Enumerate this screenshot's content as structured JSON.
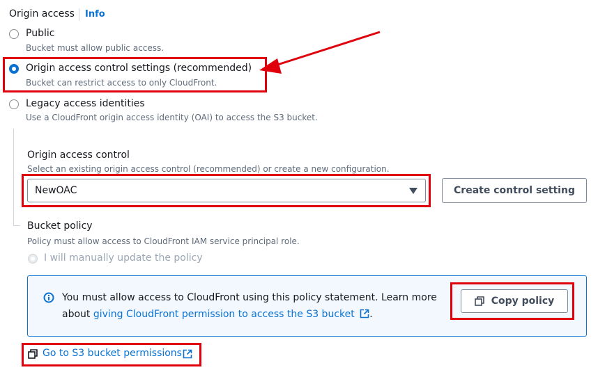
{
  "origin_access": {
    "title": "Origin access",
    "info": "Info",
    "options": [
      {
        "label": "Public",
        "desc": "Bucket must allow public access."
      },
      {
        "label": "Origin access control settings (recommended)",
        "desc": "Bucket can restrict access to only CloudFront."
      },
      {
        "label": "Legacy access identities",
        "desc": "Use a CloudFront origin access identity (OAI) to access the S3 bucket."
      }
    ],
    "selected_index": 1
  },
  "oac": {
    "label": "Origin access control",
    "desc": "Select an existing origin access control (recommended) or create a new configuration.",
    "value": "NewOAC",
    "create_button": "Create control setting"
  },
  "bucket_policy": {
    "label": "Bucket policy",
    "desc": "Policy must allow access to CloudFront IAM service principal role.",
    "option": "I will manually update the policy"
  },
  "alert": {
    "text_part1": "You must allow access to CloudFront using this policy statement. Learn more",
    "text_part2_prefix": "about ",
    "link_text": "giving CloudFront permission to access the S3 bucket",
    "text_suffix": ".",
    "copy_button": "Copy policy"
  },
  "s3_link": {
    "text": "Go to S3 bucket permissions"
  },
  "colors": {
    "accent": "#0972d3",
    "annotation_red": "#e0000c",
    "alert_bg": "#f2f8fd",
    "alert_border": "#0972d3"
  }
}
